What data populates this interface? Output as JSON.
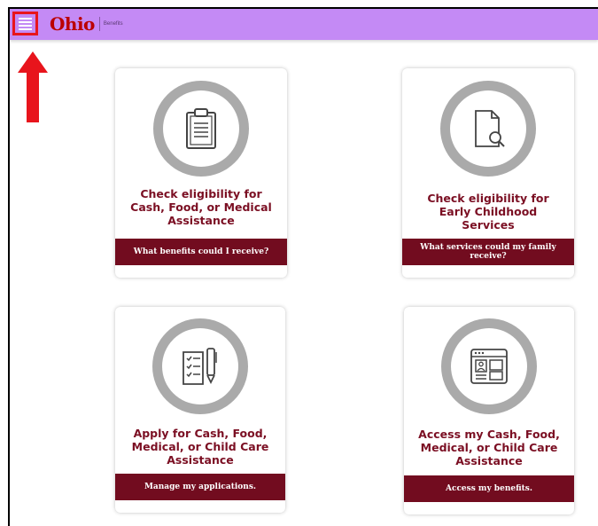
{
  "header": {
    "logo_text": "Ohio",
    "logo_subtext": "Benefits",
    "menu_icon": "hamburger-menu-icon",
    "background": "#c48af5"
  },
  "annotation": {
    "arrow_color": "#e8141c",
    "arrow_icon": "red-up-arrow-icon"
  },
  "cards": [
    {
      "title": "Check eligibility for Cash, Food, or Medical Assistance",
      "button_label": "What benefits could I receive?",
      "icon": "clipboard-icon"
    },
    {
      "title": "Check eligibility for Early Childhood Services",
      "button_label": "What services could my family receive?",
      "icon": "document-search-icon"
    },
    {
      "title": "Apply for Cash, Food, Medical, or Child Care Assistance",
      "button_label": "Manage my applications.",
      "icon": "checklist-pen-icon"
    },
    {
      "title": "Access my Cash, Food, Medical, or Child Care Assistance",
      "button_label": "Access my benefits.",
      "icon": "browser-profile-icon"
    }
  ],
  "colors": {
    "accent": "#720c1f",
    "title_color": "#7b0f23",
    "ring_color": "#aaaaaa"
  }
}
